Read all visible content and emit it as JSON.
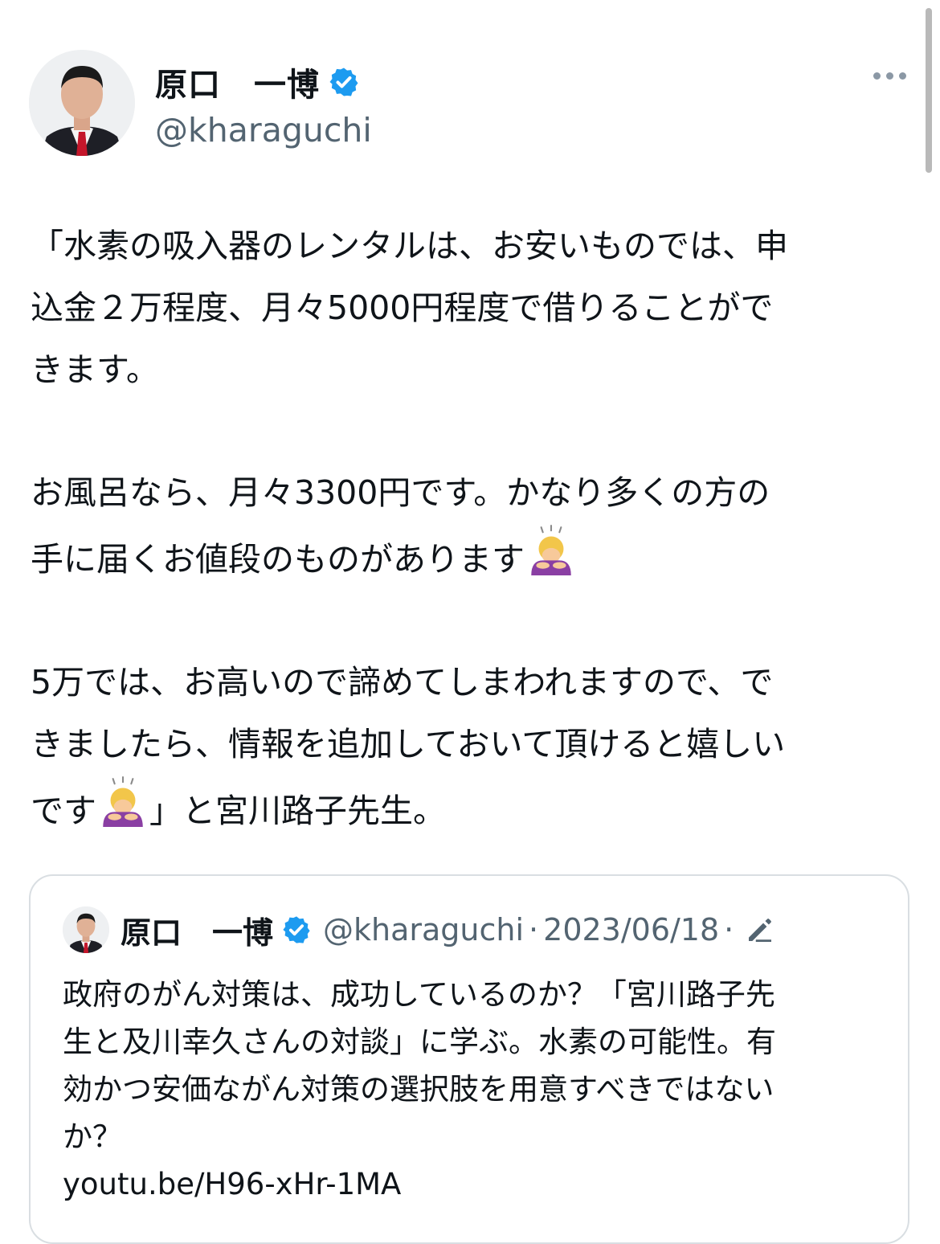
{
  "author": {
    "display_name": "原口　一博",
    "handle": "@kharaguchi",
    "verified_icon": "verified-badge-icon",
    "avatar_icon": "profile-photo"
  },
  "more_icon": "more-options-icon",
  "tweet": {
    "paragraphs": [
      {
        "lines": [
          "「水素の吸入器のレンタルは、お安いものでは、申",
          "込金２万程度、月々5000円程度で借りることがで",
          "きます。"
        ]
      },
      {
        "lines": [
          "お風呂なら、月々3300円です。かなり多くの方の",
          "手に届くお値段のものがあります"
        ],
        "emoji": "person-bowing-emoji"
      },
      {
        "lines": [
          "5万では、お高いので諦めてしまわれますので、で",
          "きましたら、情報を追加しておいて頂けると嬉しい",
          "です",
          "」と宮川路子先生。"
        ]
      }
    ]
  },
  "quoted_tweet": {
    "display_name": "原口　一博",
    "handle": "@kharaguchi",
    "separator": "·",
    "date": "2023/06/18",
    "edit_icon": "edited-pencil-icon",
    "lines": [
      "政府のがん対策は、成功しているのか？「宮川路子先",
      "生と及川幸久さんの対談」に学ぶ。水素の可能性。有",
      "効かつ安価ながん対策の選択肢を用意すべきではない",
      "か？",
      "youtu.be/H96-xHr-1MA"
    ]
  },
  "colors": {
    "text": "#0f1419",
    "secondary": "#536471",
    "verified": "#1d9bf0",
    "border": "#d9dee2"
  }
}
